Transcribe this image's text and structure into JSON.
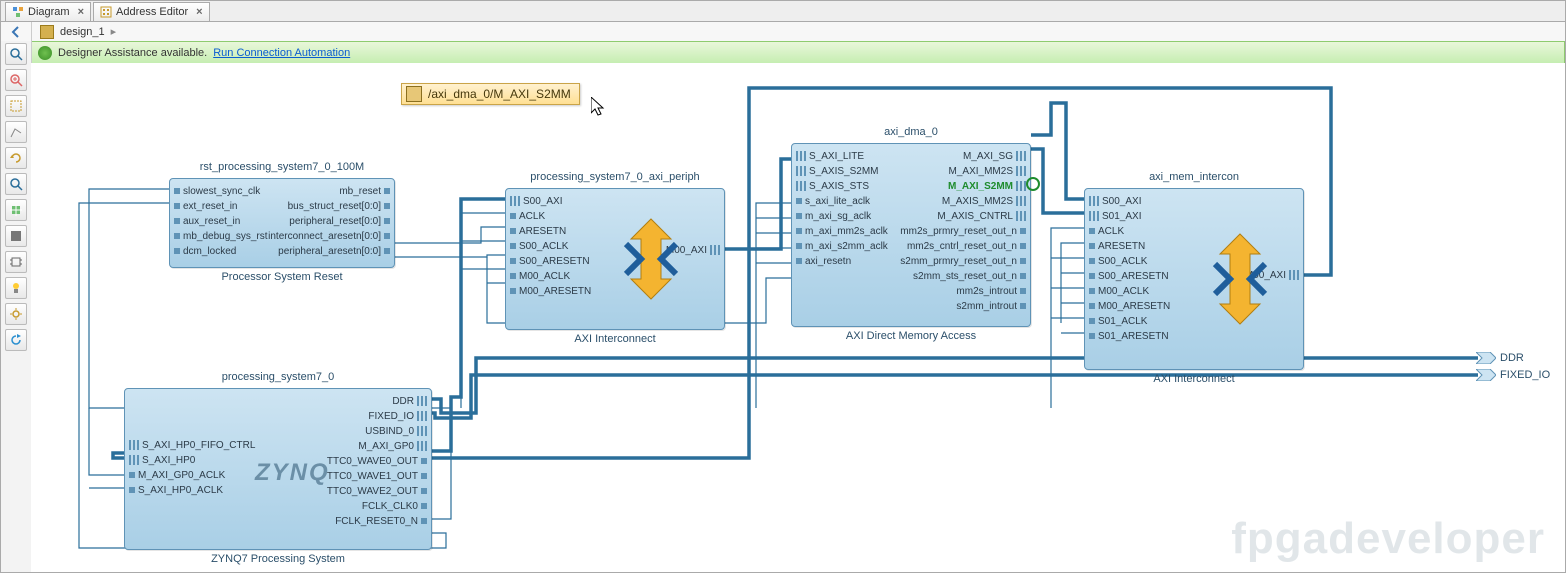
{
  "tabs": [
    {
      "label": "Diagram",
      "icon": "diagram-icon",
      "active": true
    },
    {
      "label": "Address Editor",
      "icon": "address-editor-icon",
      "active": false
    }
  ],
  "breadcrumb": {
    "design": "design_1"
  },
  "assist": {
    "text": "Designer Assistance available.",
    "link": "Run Connection Automation"
  },
  "tooltip": {
    "path": "/axi_dma_0/M_AXI_S2MM"
  },
  "external_ports": {
    "ddr": "DDR",
    "fixed_io": "FIXED_IO"
  },
  "toolbar": [
    "go-back-icon",
    "zoom-fit-icon",
    "zoom-in-icon",
    "select-icon",
    "connect-icon",
    "rotate-icon",
    "magnify-icon",
    "add-ip-icon",
    "validate-icon",
    "chip-icon",
    "highlight-icon",
    "settings-icon",
    "refresh-icon"
  ],
  "blocks": {
    "rst": {
      "title": "rst_processing_system7_0_100M",
      "subtitle": "Processor System Reset",
      "left": [
        "slowest_sync_clk",
        "ext_reset_in",
        "aux_reset_in",
        "mb_debug_sys_rst",
        "dcm_locked"
      ],
      "right": [
        "mb_reset",
        "bus_struct_reset[0:0]",
        "peripheral_reset[0:0]",
        "interconnect_aresetn[0:0]",
        "peripheral_aresetn[0:0]"
      ]
    },
    "periph": {
      "title": "processing_system7_0_axi_periph",
      "subtitle": "AXI Interconnect",
      "left": [
        "S00_AXI",
        "ACLK",
        "ARESETN",
        "S00_ACLK",
        "S00_ARESETN",
        "M00_ACLK",
        "M00_ARESETN"
      ],
      "right": [
        "M00_AXI"
      ]
    },
    "dma": {
      "title": "axi_dma_0",
      "subtitle": "AXI Direct Memory Access",
      "left": [
        "S_AXI_LITE",
        "S_AXIS_S2MM",
        "S_AXIS_STS",
        "s_axi_lite_aclk",
        "m_axi_sg_aclk",
        "m_axi_mm2s_aclk",
        "m_axi_s2mm_aclk",
        "axi_resetn"
      ],
      "right": [
        "M_AXI_SG",
        "M_AXI_MM2S",
        "M_AXI_S2MM",
        "M_AXIS_MM2S",
        "M_AXIS_CNTRL",
        "mm2s_prmry_reset_out_n",
        "mm2s_cntrl_reset_out_n",
        "s2mm_prmry_reset_out_n",
        "s2mm_sts_reset_out_n",
        "mm2s_introut",
        "s2mm_introut"
      ]
    },
    "mem": {
      "title": "axi_mem_intercon",
      "subtitle": "AXI Interconnect",
      "left": [
        "S00_AXI",
        "S01_AXI",
        "ACLK",
        "ARESETN",
        "S00_ACLK",
        "S00_ARESETN",
        "M00_ACLK",
        "M00_ARESETN",
        "S01_ACLK",
        "S01_ARESETN"
      ],
      "right": [
        "M00_AXI"
      ]
    },
    "ps": {
      "title": "processing_system7_0",
      "subtitle": "ZYNQ7 Processing System",
      "logo": "ZYNQ",
      "left": [
        "S_AXI_HP0_FIFO_CTRL",
        "S_AXI_HP0",
        "M_AXI_GP0_ACLK",
        "S_AXI_HP0_ACLK"
      ],
      "right": [
        "DDR",
        "FIXED_IO",
        "USBIND_0",
        "M_AXI_GP0",
        "TTC0_WAVE0_OUT",
        "TTC0_WAVE1_OUT",
        "TTC0_WAVE2_OUT",
        "FCLK_CLK0",
        "FCLK_RESET0_N"
      ]
    }
  },
  "watermark": "fpgadeveloper"
}
